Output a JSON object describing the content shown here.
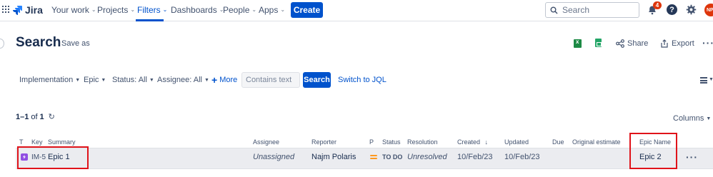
{
  "app": {
    "name": "Jira"
  },
  "nav": {
    "items": [
      {
        "label": "Your work",
        "has_menu": true
      },
      {
        "label": "Projects",
        "has_menu": true
      },
      {
        "label": "Filters",
        "has_menu": true,
        "active": true
      },
      {
        "label": "Dashboards",
        "has_menu": true
      },
      {
        "label": "People",
        "has_menu": true
      },
      {
        "label": "Apps",
        "has_menu": true
      }
    ],
    "create_label": "Create",
    "search_placeholder": "Search",
    "notification_count": "4",
    "help_label": "?",
    "avatar_initials": "NP"
  },
  "header": {
    "title": "Search",
    "save_as": "Save as",
    "share": "Share",
    "export": "Export"
  },
  "filters": {
    "items": [
      {
        "label": "Implementation"
      },
      {
        "label": "Epic"
      },
      {
        "label": "Status: All"
      },
      {
        "label": "Assignee: All"
      }
    ],
    "more_label": "More",
    "text_placeholder": "Contains text",
    "search_button": "Search",
    "switch_jql": "Switch to JQL"
  },
  "results": {
    "count_range": "1–1",
    "count_of": "of",
    "count_total": "1",
    "columns_button": "Columns",
    "columns": [
      "T",
      "Key",
      "Summary",
      "Assignee",
      "Reporter",
      "P",
      "Status",
      "Resolution",
      "Created",
      "Updated",
      "Due",
      "Original estimate",
      "Epic Name"
    ],
    "rows": [
      {
        "type_icon": "epic-icon",
        "key": "IM-5",
        "summary": "Epic 1",
        "assignee": "Unassigned",
        "reporter": "Najm Polaris",
        "priority_icon": "medium-priority-icon",
        "status": "TO DO",
        "resolution": "Unresolved",
        "created": "10/Feb/23",
        "updated": "10/Feb/23",
        "due": "",
        "original_estimate": "",
        "epic_name": "Epic 2"
      }
    ]
  },
  "colors": {
    "brand_blue": "#0052cc",
    "epic_purple": "#904ee2",
    "highlight_red": "#e0131a",
    "priority_orange": "#ff991f"
  }
}
